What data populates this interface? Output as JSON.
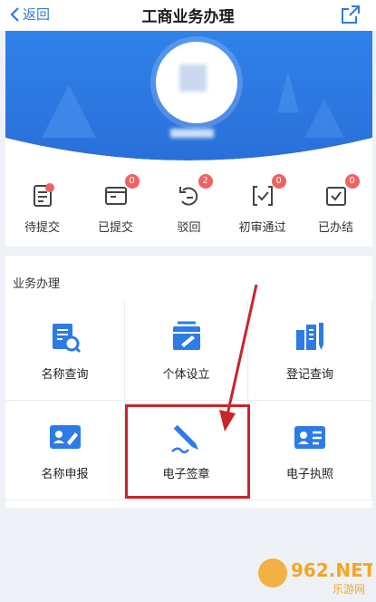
{
  "nav": {
    "back_label": "返回",
    "title": "工商业务办理"
  },
  "status_items": [
    {
      "label": "待提交",
      "badge": "",
      "icon": "document-pending-icon"
    },
    {
      "label": "已提交",
      "badge": "0",
      "icon": "folder-submitted-icon"
    },
    {
      "label": "驳回",
      "badge": "2",
      "icon": "rejected-icon"
    },
    {
      "label": "初审通过",
      "badge": "0",
      "icon": "preliminary-approved-icon"
    },
    {
      "label": "已办结",
      "badge": "0",
      "icon": "completed-icon"
    }
  ],
  "business": {
    "section_title": "业务办理",
    "items": [
      {
        "label": "名称查询",
        "icon": "name-search-icon"
      },
      {
        "label": "个体设立",
        "icon": "individual-setup-icon"
      },
      {
        "label": "登记查询",
        "icon": "registration-query-icon"
      },
      {
        "label": "名称申报",
        "icon": "name-declaration-icon"
      },
      {
        "label": "电子签章",
        "icon": "e-signature-icon"
      },
      {
        "label": "电子执照",
        "icon": "e-license-icon"
      }
    ]
  },
  "watermark": {
    "text": "962.NET",
    "subtext": "乐游网"
  },
  "colors": {
    "primary": "#2d7be5",
    "badge": "#ef6262",
    "highlight": "#c8262b"
  }
}
